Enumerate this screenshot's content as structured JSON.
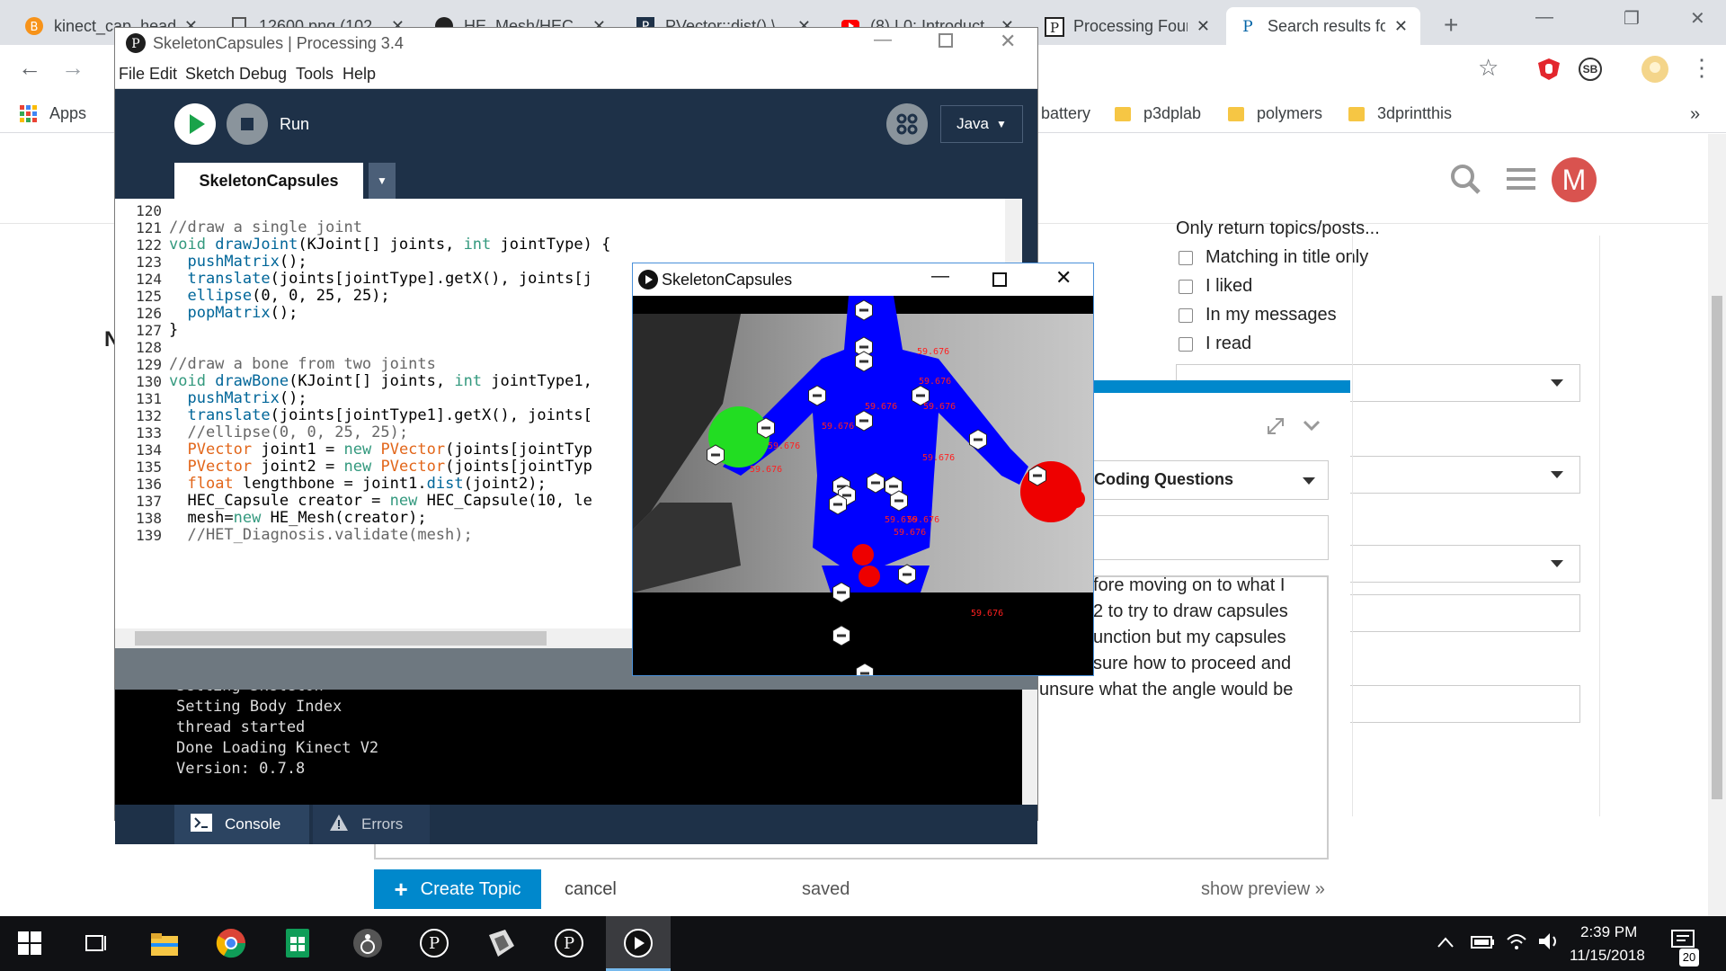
{
  "browser": {
    "tabs": [
      {
        "label": "kinect_cap_head"
      },
      {
        "label": "12600.png (102"
      },
      {
        "label": "HE_Mesh/HEC_"
      },
      {
        "label": "PVector::dist() \\"
      },
      {
        "label": "(8) L0: Introduct"
      },
      {
        "label": "Processing Four"
      },
      {
        "label": "Search results fo",
        "active": true
      }
    ],
    "tab_close": "✕",
    "new_tab": "+",
    "win_min": "—",
    "win_restore": "❐",
    "win_close": "✕",
    "nav": {
      "back": "←",
      "forward": "→",
      "star": "☆",
      "menu": "⋮"
    },
    "bookmarks": [
      {
        "label": "Apps"
      },
      {
        "label": "battery"
      },
      {
        "label": "p3dplab"
      },
      {
        "label": "polymers"
      },
      {
        "label": "3dprintthis"
      }
    ],
    "bookmarks_more": "»",
    "ext_sb": "SB"
  },
  "forum": {
    "avatar_letter": "M",
    "left_partial": "N",
    "filters": {
      "heading": "Only return topics/posts...",
      "options": [
        "Matching in title only",
        "I liked",
        "In my messages",
        "I read"
      ]
    },
    "category": "Coding Questions",
    "body_lines": [
      "fore moving on to what I",
      "2 to try to draw capsules",
      "unction but my capsules",
      "sure how to proceed and",
      "unsure what the angle would be"
    ],
    "create_button": "Create Topic",
    "create_plus": "+",
    "cancel": "cancel",
    "saved": "saved",
    "show_preview": "show preview »",
    "accent_color": "#0088cc"
  },
  "ide": {
    "title": "SkeletonCapsules | Processing 3.4",
    "menu": [
      "File",
      "Edit",
      "Sketch",
      "Debug",
      "Tools",
      "Help"
    ],
    "run_label": "Run",
    "mode": "Java",
    "mode_caret": "▼",
    "tab_name": "SkeletonCapsules",
    "tab_caret": "▼",
    "code": [
      {
        "n": "120",
        "t": ""
      },
      {
        "n": "121",
        "t": "//draw a single joint"
      },
      {
        "n": "122",
        "t": "void drawJoint(KJoint[] joints, int jointType) {"
      },
      {
        "n": "123",
        "t": "  pushMatrix();"
      },
      {
        "n": "124",
        "t": "  translate(joints[jointType].getX(), joints[j"
      },
      {
        "n": "125",
        "t": "  ellipse(0, 0, 25, 25);"
      },
      {
        "n": "126",
        "t": "  popMatrix();"
      },
      {
        "n": "127",
        "t": "}"
      },
      {
        "n": "128",
        "t": ""
      },
      {
        "n": "129",
        "t": "//draw a bone from two joints"
      },
      {
        "n": "130",
        "t": "void drawBone(KJoint[] joints, int jointType1,"
      },
      {
        "n": "131",
        "t": "  pushMatrix();"
      },
      {
        "n": "132",
        "t": "  translate(joints[jointType1].getX(), joints["
      },
      {
        "n": "133",
        "t": "  //ellipse(0, 0, 25, 25);"
      },
      {
        "n": "134",
        "t": "  PVector joint1 = new PVector(joints[jointTyp"
      },
      {
        "n": "135",
        "t": "  PVector joint2 = new PVector(joints[jointTyp"
      },
      {
        "n": "136",
        "t": "  float lengthbone = joint1.dist(joint2);"
      },
      {
        "n": "137",
        "t": "  HEC_Capsule creator = new HEC_Capsule(10, le"
      },
      {
        "n": "138",
        "t": "  mesh=new HE_Mesh(creator);"
      },
      {
        "n": "139",
        "t": "  //HET_Diagnosis.validate(mesh);"
      }
    ],
    "console": [
      "Setting Skeleton",
      "Setting Body Index",
      "thread started",
      "Done Loading Kinect V2",
      "Version: 0.7.8"
    ],
    "console_tab": "Console",
    "errors_tab": "Errors",
    "bg_color": "#1e3148"
  },
  "sketch": {
    "title": "SkeletonCapsules",
    "labels": [
      "59.676",
      "59.676",
      "59.676",
      "59.676",
      "59.676",
      "59.676",
      "59.676",
      "59.676",
      "59.676",
      "59.676",
      "59.676",
      "59.676"
    ],
    "body_color": "#0000ff",
    "left_hand_color": "#22dd22",
    "right_hand_color": "#ee0000"
  },
  "taskbar": {
    "time": "2:39 PM",
    "date": "11/15/2018",
    "notifications": "20"
  }
}
